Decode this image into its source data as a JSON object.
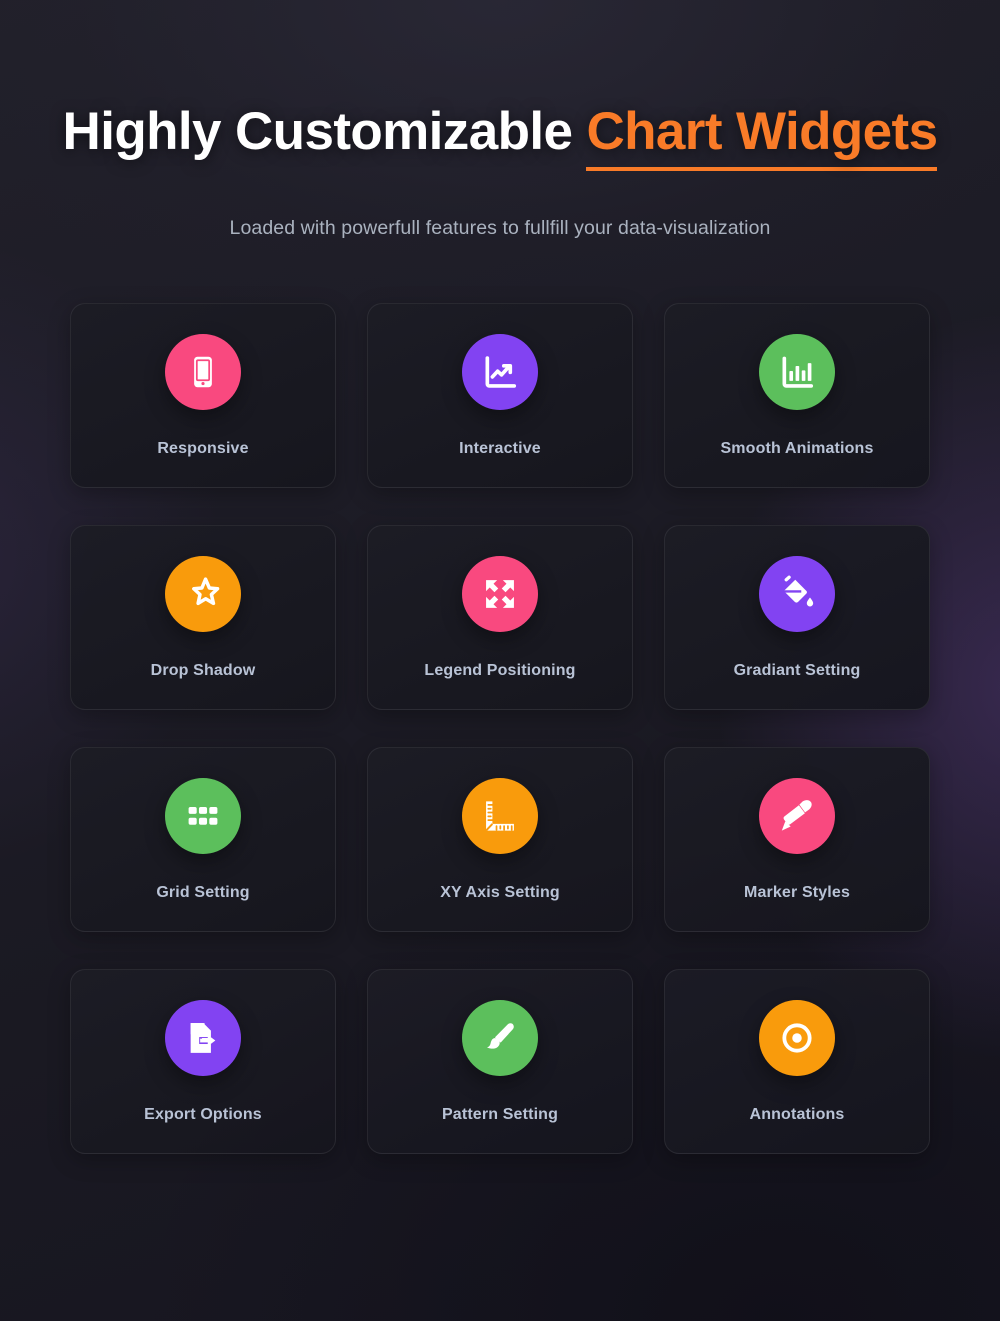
{
  "theme": {
    "page_bg": "#1c1b24",
    "card_bg": "#1c1c25",
    "accent_orange": "#f97b28",
    "label_color": "#b9c3d6",
    "subtitle_color": "#aab2bf",
    "icon_colors": {
      "pink": "#f9497f",
      "purple": "#8243f2",
      "green": "#5cbf5c",
      "orange": "#f99b0c"
    }
  },
  "header": {
    "title_plain": "Highly Customizable ",
    "title_accent": "Chart Widgets",
    "subtitle": "Loaded with powerfull features to fullfill your data-visualization"
  },
  "features": [
    {
      "label": "Responsive",
      "icon": "mobile-phone-icon",
      "color": "#f9497f"
    },
    {
      "label": "Interactive",
      "icon": "line-chart-icon",
      "color": "#8243f2"
    },
    {
      "label": "Smooth Animations",
      "icon": "bar-chart-icon",
      "color": "#5cbf5c"
    },
    {
      "label": "Drop Shadow",
      "icon": "half-star-icon",
      "color": "#f99b0c"
    },
    {
      "label": "Legend Positioning",
      "icon": "expand-arrows-icon",
      "color": "#f9497f"
    },
    {
      "label": "Gradiant Setting",
      "icon": "paint-bucket-icon",
      "color": "#8243f2"
    },
    {
      "label": "Grid Setting",
      "icon": "grid-squares-icon",
      "color": "#5cbf5c"
    },
    {
      "label": "XY Axis Setting",
      "icon": "ruler-icon",
      "color": "#f99b0c"
    },
    {
      "label": "Marker Styles",
      "icon": "marker-pen-icon",
      "color": "#f9497f"
    },
    {
      "label": "Export Options",
      "icon": "file-export-icon",
      "color": "#8243f2"
    },
    {
      "label": "Pattern Setting",
      "icon": "paint-brush-icon",
      "color": "#5cbf5c"
    },
    {
      "label": "Annotations",
      "icon": "bullseye-target-icon",
      "color": "#f99b0c"
    }
  ]
}
